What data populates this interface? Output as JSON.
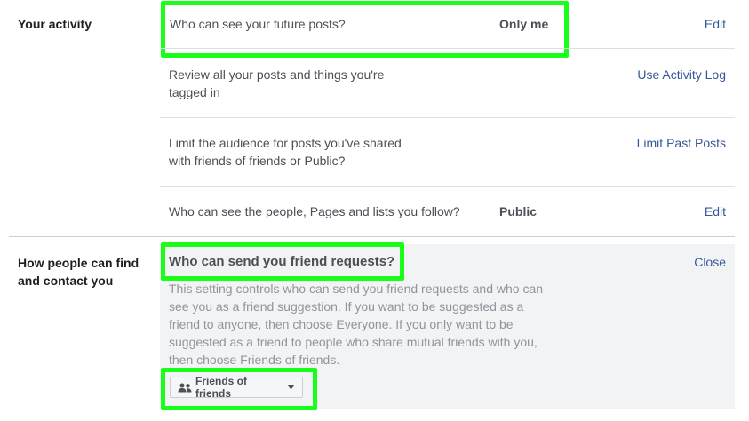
{
  "activity": {
    "section_label": "Your activity",
    "rows": [
      {
        "text": "Who can see your future posts?",
        "value": "Only me",
        "action": "Edit"
      },
      {
        "text_line1": "Review all your posts and things you're",
        "text_line2": "tagged in",
        "action": "Use Activity Log"
      },
      {
        "text_line1": "Limit the audience for posts you've shared",
        "text_line2": "with friends of friends or Public?",
        "action": "Limit Past Posts"
      },
      {
        "text": "Who can see the people, Pages and lists you follow?",
        "value": "Public",
        "action": "Edit"
      }
    ]
  },
  "find_contact": {
    "section_label_line1": "How people can find",
    "section_label_line2": "and contact you",
    "friend_requests": {
      "title": "Who can send you friend requests?",
      "close": "Close",
      "description_lines": [
        "This setting controls who can send you friend requests and who can",
        "see you as a friend suggestion. If you want to be suggested as a",
        "friend to anyone, then choose Everyone. If you only want to be",
        "suggested as a friend to people who share mutual friends with you,",
        "then choose Friends of friends."
      ],
      "dropdown_value": "Friends of friends",
      "dropdown_icon": "friends-icon"
    }
  },
  "colors": {
    "highlight": "#1aff1a",
    "link": "#365899",
    "expanded_background": "#f2f3f5"
  }
}
